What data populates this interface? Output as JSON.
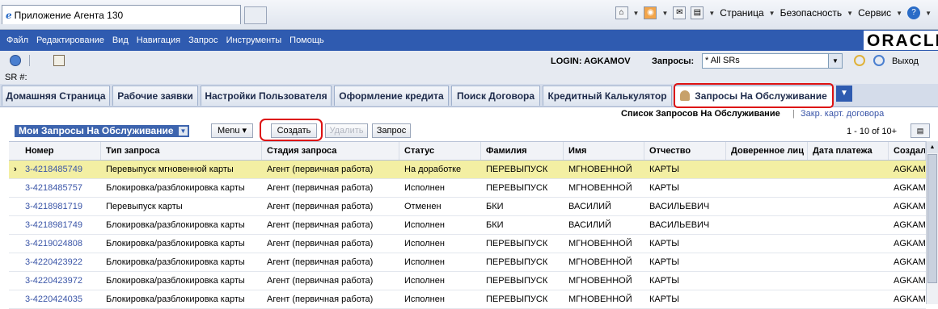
{
  "browser": {
    "tab_title": "Приложение Агента 130",
    "tools": [
      "Страница",
      "Безопасность",
      "Сервис"
    ]
  },
  "menu": [
    "Файл",
    "Редактирование",
    "Вид",
    "Навигация",
    "Запрос",
    "Инструменты",
    "Помощь"
  ],
  "brand": "ORACLE",
  "toolbar": {
    "login": "LOGIN: AGKAMOV",
    "queries_label": "Запросы:",
    "queries_value": "* All SRs",
    "exit": "Выход"
  },
  "sr_label": "SR #:",
  "tabs": [
    "Домашняя Страница",
    "Рабочие заявки",
    "Настройки Пользователя",
    "Оформление кредита",
    "Поиск Договора",
    "Кредитный Калькулятор",
    "Запросы На Обслуживание"
  ],
  "sublinks": {
    "active": "Список Запросов На Обслуживание",
    "link": "Закр. карт. договора"
  },
  "list": {
    "title": "Мои Запросы На Обслуживание",
    "buttons": {
      "menu": "Menu ▾",
      "create": "Создать",
      "delete": "Удалить",
      "query": "Запрос"
    },
    "pager": "1 - 10 of 10+"
  },
  "table": {
    "columns": [
      "Номер",
      "Тип запроса",
      "Стадия запроса",
      "Статус",
      "Фамилия",
      "Имя",
      "Отчество",
      "Доверенное лиц",
      "Дата платежа",
      "Создал"
    ],
    "rows": [
      [
        "3-4218485749",
        "Перевыпуск мгновенной карты",
        "Агент (первичная работа)",
        "На доработке",
        "ПЕРЕВЫПУСК",
        "МГНОВЕННОЙ",
        "КАРТЫ",
        "",
        "",
        "AGKAM"
      ],
      [
        "3-4218485757",
        "Блокировка/разблокировка карты",
        "Агент (первичная работа)",
        "Исполнен",
        "ПЕРЕВЫПУСК",
        "МГНОВЕННОЙ",
        "КАРТЫ",
        "",
        "",
        "AGKAM"
      ],
      [
        "3-4218981719",
        "Перевыпуск карты",
        "Агент (первичная работа)",
        "Отменен",
        "БКИ",
        "ВАСИЛИЙ",
        "ВАСИЛЬЕВИЧ",
        "",
        "",
        "AGKAM"
      ],
      [
        "3-4218981749",
        "Блокировка/разблокировка карты",
        "Агент (первичная работа)",
        "Исполнен",
        "БКИ",
        "ВАСИЛИЙ",
        "ВАСИЛЬЕВИЧ",
        "",
        "",
        "AGKAM"
      ],
      [
        "3-4219024808",
        "Блокировка/разблокировка карты",
        "Агент (первичная работа)",
        "Исполнен",
        "ПЕРЕВЫПУСК",
        "МГНОВЕННОЙ",
        "КАРТЫ",
        "",
        "",
        "AGKAM"
      ],
      [
        "3-4220423922",
        "Блокировка/разблокировка карты",
        "Агент (первичная работа)",
        "Исполнен",
        "ПЕРЕВЫПУСК",
        "МГНОВЕННОЙ",
        "КАРТЫ",
        "",
        "",
        "AGKAM"
      ],
      [
        "3-4220423972",
        "Блокировка/разблокировка карты",
        "Агент (первичная работа)",
        "Исполнен",
        "ПЕРЕВЫПУСК",
        "МГНОВЕННОЙ",
        "КАРТЫ",
        "",
        "",
        "AGKAM"
      ],
      [
        "3-4220424035",
        "Блокировка/разблокировка карты",
        "Агент (первичная работа)",
        "Исполнен",
        "ПЕРЕВЫПУСК",
        "МГНОВЕННОЙ",
        "КАРТЫ",
        "",
        "",
        "AGKAM"
      ]
    ]
  },
  "colors": {
    "menu_bg": "#2f5bb0",
    "selected_row": "#f3efa3",
    "highlight": "#dd1111"
  }
}
